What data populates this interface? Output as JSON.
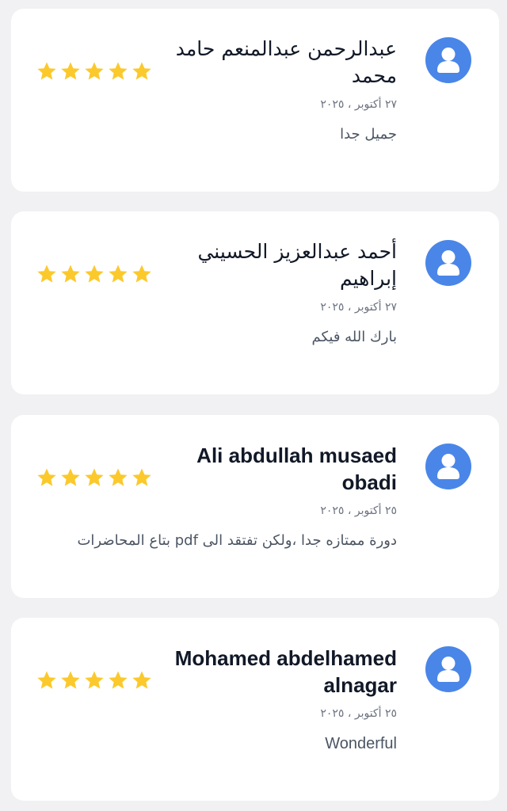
{
  "reviews": [
    {
      "name": "عبدالرحمن عبدالمنعم حامد محمد",
      "date": "٢٧ أكتوبر ، ٢٠٢٥",
      "comment": "جميل جدا",
      "rating": 5
    },
    {
      "name": "أحمد عبدالعزيز الحسيني إبراهيم",
      "date": "٢٧ أكتوبر ، ٢٠٢٥",
      "comment": "بارك الله فيكم",
      "rating": 5
    },
    {
      "name": "Ali abdullah musaed obadi",
      "date": "٢٥ أكتوبر ، ٢٠٢٥",
      "comment": "دورة ممتازه جدا ،ولكن تفتقد الى pdf بتاع المحاضرات",
      "rating": 5
    },
    {
      "name": "Mohamed abdelhamed alnagar",
      "date": "٢٥ أكتوبر ، ٢٠٢٥",
      "comment": "Wonderful",
      "rating": 5
    }
  ],
  "colors": {
    "background": "#f1f1f3",
    "card": "#ffffff",
    "avatar": "#4a86e8",
    "star": "#fbc92b",
    "name": "#111827",
    "date": "#6b7280",
    "comment": "#4b5563"
  },
  "icons": {
    "avatar": "user-avatar-icon",
    "star": "star-icon"
  }
}
